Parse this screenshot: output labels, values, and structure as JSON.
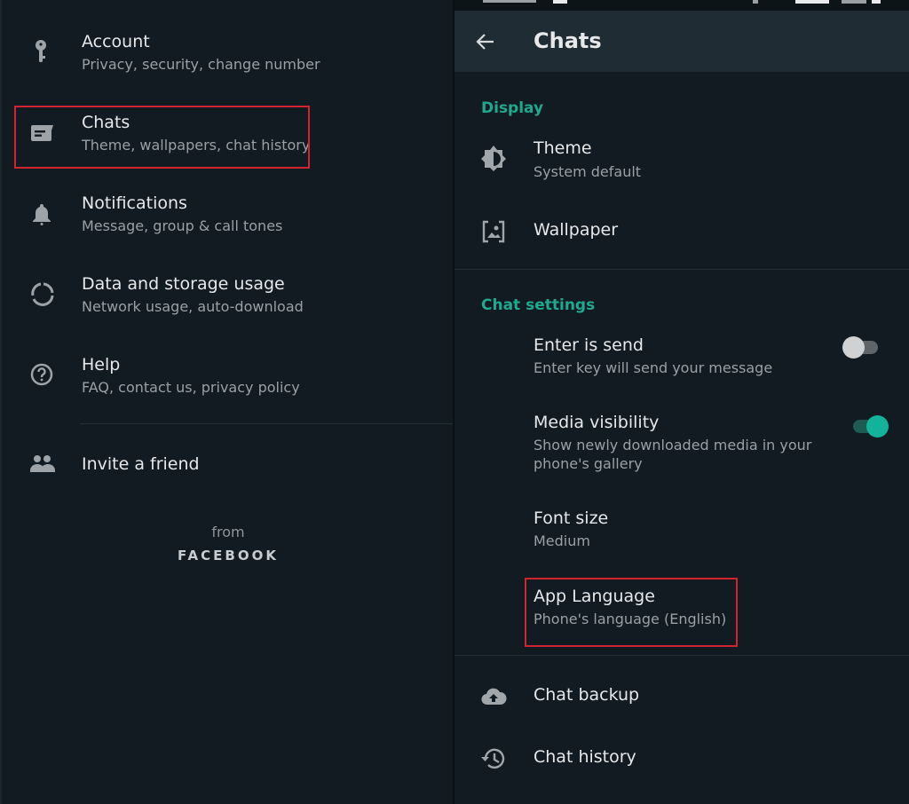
{
  "left_panel": {
    "items": [
      {
        "icon": "key-icon",
        "title": "Account",
        "subtitle": "Privacy, security, change number"
      },
      {
        "icon": "chat-icon",
        "title": "Chats",
        "subtitle": "Theme, wallpapers, chat history",
        "highlighted": true
      },
      {
        "icon": "bell-icon",
        "title": "Notifications",
        "subtitle": "Message, group & call tones"
      },
      {
        "icon": "data-usage-icon",
        "title": "Data and storage usage",
        "subtitle": "Network usage, auto-download"
      },
      {
        "icon": "help-icon",
        "title": "Help",
        "subtitle": "FAQ, contact us, privacy policy"
      }
    ],
    "invite": {
      "icon": "people-icon",
      "title": "Invite a friend"
    },
    "footer": {
      "from": "from",
      "brand": "FACEBOOK"
    }
  },
  "right_panel": {
    "appbar": {
      "back_icon": "arrow-back-icon",
      "title": "Chats"
    },
    "sections": {
      "display": {
        "header": "Display",
        "items": [
          {
            "icon": "theme-icon",
            "title": "Theme",
            "subtitle": "System default"
          },
          {
            "icon": "wallpaper-icon",
            "title": "Wallpaper"
          }
        ]
      },
      "chat_settings": {
        "header": "Chat settings",
        "items": [
          {
            "title": "Enter is send",
            "subtitle": "Enter key will send your message",
            "toggle": false
          },
          {
            "title": "Media visibility",
            "subtitle": "Show newly downloaded media in your phone's gallery",
            "toggle": true
          },
          {
            "title": "Font size",
            "subtitle": "Medium"
          },
          {
            "title": "App Language",
            "subtitle": "Phone's language (English)",
            "highlighted": true
          }
        ]
      },
      "other": {
        "items": [
          {
            "icon": "cloud-upload-icon",
            "title": "Chat backup"
          },
          {
            "icon": "history-icon",
            "title": "Chat history"
          }
        ]
      }
    }
  },
  "colors": {
    "background": "#121b22",
    "appbar": "#1f2c33",
    "accent": "#1fa98e",
    "highlight_box": "#d3232f",
    "toggle_on": "#12b39a"
  }
}
